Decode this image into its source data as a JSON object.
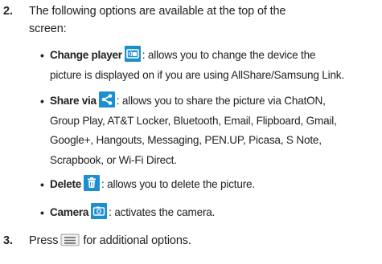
{
  "step2": {
    "number": "2.",
    "text_line1": "The following options are available at the top of the",
    "text_line2": "screen:"
  },
  "bullets": [
    {
      "term": "Change player",
      "icon": "change-player-icon",
      "desc_line1": ": allows you to change the device the",
      "desc_line2": "picture is displayed on if you are using AllShare/Samsung Link."
    },
    {
      "term": "Share via",
      "icon": "share-icon",
      "desc_line1": ": allows you to share the picture via ChatON,",
      "desc_line2": "Group Play, AT&T Locker, Bluetooth, Email, Flipboard, Gmail,",
      "desc_line3": "Google+, Hangouts, Messaging, PEN.UP, Picasa, S Note,",
      "desc_line4": "Scrapbook, or Wi-Fi Direct."
    },
    {
      "term": "Delete",
      "icon": "trash-icon",
      "desc_line1": ": allows you to delete the picture."
    },
    {
      "term": "Camera",
      "icon": "camera-icon",
      "desc_line1": ": activates the camera."
    }
  ],
  "step3": {
    "number": "3.",
    "text_before": "Press",
    "icon": "menu-icon",
    "text_after": "for additional options."
  },
  "colors": {
    "icon_background": "#1b8fd0",
    "icon_foreground": "#ffffff",
    "text": "#222222"
  }
}
